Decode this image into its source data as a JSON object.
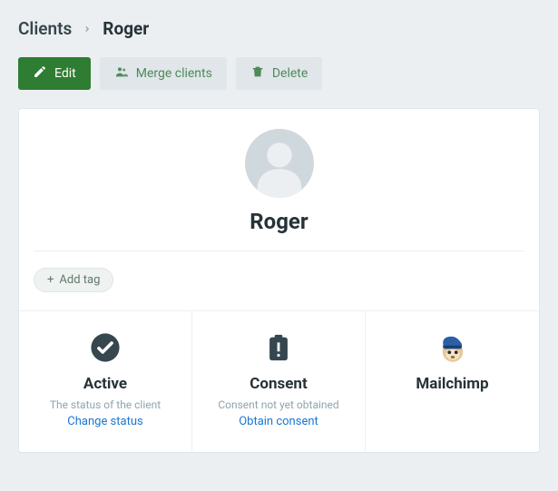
{
  "breadcrumb": {
    "root": "Clients",
    "current": "Roger"
  },
  "actions": {
    "edit": "Edit",
    "merge": "Merge clients",
    "delete": "Delete"
  },
  "client": {
    "name": "Roger"
  },
  "tags": {
    "add_label": "Add tag"
  },
  "status_cards": {
    "active": {
      "title": "Active",
      "subtitle": "The status of the client",
      "link": "Change status"
    },
    "consent": {
      "title": "Consent",
      "subtitle": "Consent not yet obtained",
      "link": "Obtain consent"
    },
    "mailchimp": {
      "title": "Mailchimp"
    }
  }
}
